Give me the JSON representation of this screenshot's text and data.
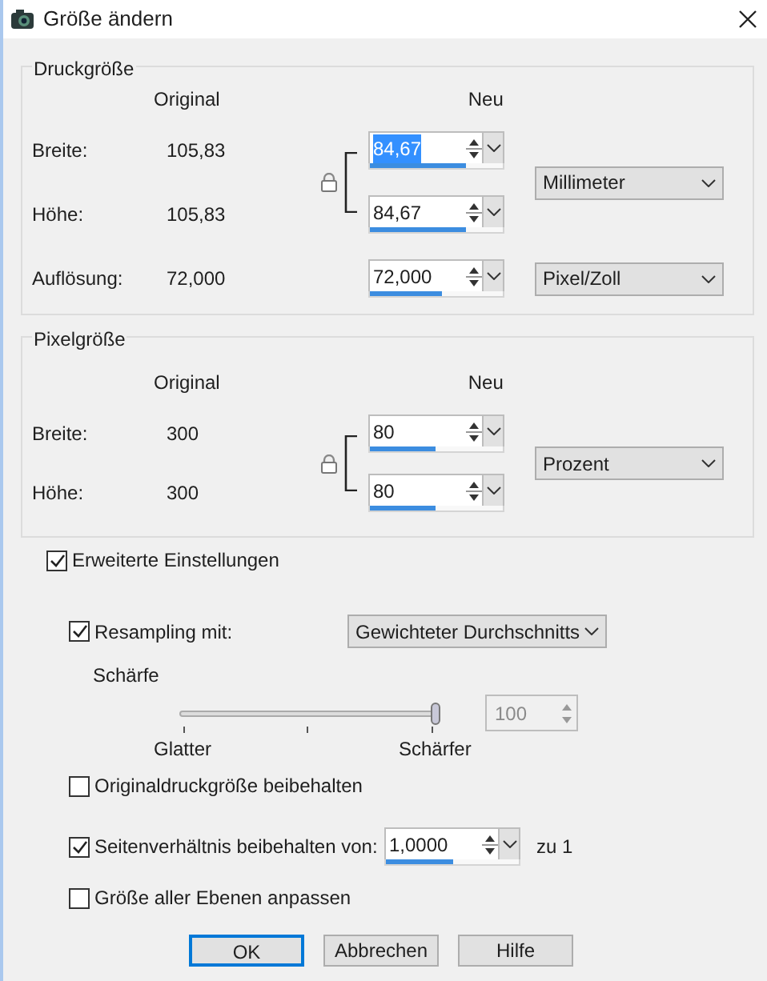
{
  "window": {
    "title": "Größe ändern"
  },
  "print_size": {
    "legend": "Druckgröße",
    "header_original": "Original",
    "header_new": "Neu",
    "rows": [
      {
        "label": "Breite:",
        "original": "105,83",
        "value": "84,67",
        "text_selected": true,
        "level": 0.72
      },
      {
        "label": "Höhe:",
        "original": "105,83",
        "value": "84,67",
        "text_selected": false,
        "level": 0.72
      }
    ],
    "unit": "Millimeter",
    "resolution": {
      "label": "Auflösung:",
      "original": "72,000",
      "value": "72,000",
      "text_selected": false,
      "level": 0.54,
      "unit": "Pixel/Zoll"
    }
  },
  "pixel_size": {
    "legend": "Pixelgröße",
    "header_original": "Original",
    "header_new": "Neu",
    "rows": [
      {
        "label": "Breite:",
        "original": "300",
        "value": "80",
        "text_selected": false,
        "level": 0.49
      },
      {
        "label": "Höhe:",
        "original": "300",
        "value": "80",
        "text_selected": false,
        "level": 0.49
      }
    ],
    "unit": "Prozent"
  },
  "advanced": {
    "label": "Erweiterte Einstellungen",
    "checked": true
  },
  "resampling": {
    "label": "Resampling mit:",
    "checked": true,
    "method": "Gewichteter Durchschnitts"
  },
  "sharpness": {
    "label": "Schärfe",
    "level": 1,
    "min_label": "Glatter",
    "max_label": "Schärfer",
    "value": "100",
    "disabled": true
  },
  "options": [
    {
      "kind": "checkbox",
      "label": "Originaldruckgröße beibehalten",
      "checked": false
    },
    {
      "kind": "ratio",
      "label": "Seitenverhältnis beibehalten von:",
      "checked": true,
      "value": "1,0000",
      "text_selected": false,
      "level": 0.5,
      "suffix": "zu 1"
    },
    {
      "kind": "checkbox",
      "label": "Größe aller Ebenen anpassen",
      "checked": false
    }
  ],
  "buttons": [
    {
      "label": "OK",
      "focused": true
    },
    {
      "label": "Abbrechen",
      "focused": false
    },
    {
      "label": "Hilfe",
      "focused": false
    }
  ]
}
